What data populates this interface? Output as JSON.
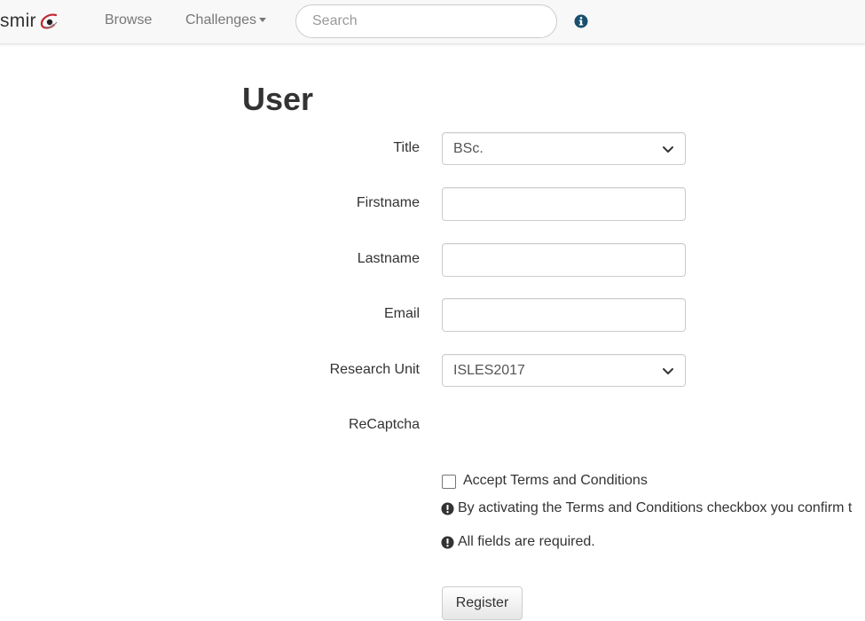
{
  "nav": {
    "brand": "smir",
    "browse": "Browse",
    "challenges": "Challenges",
    "search_placeholder": "Search",
    "info_icon": "info-circle-icon"
  },
  "page": {
    "title": "User"
  },
  "form": {
    "title_label": "Title",
    "title_value": "BSc.",
    "firstname_label": "Firstname",
    "lastname_label": "Lastname",
    "email_label": "Email",
    "research_unit_label": "Research Unit",
    "research_unit_value": "ISLES2017",
    "recaptcha_label": "ReCaptcha",
    "accept_terms_label": "Accept Terms and Conditions",
    "terms_note": "By activating the Terms and Conditions checkbox you confirm t",
    "required_note": "All fields are required.",
    "register_button": "Register"
  },
  "colors": {
    "navbar_bg": "#f8f8f8",
    "info_icon": "#1a4f6e",
    "logo_accent": "#c0272d"
  }
}
